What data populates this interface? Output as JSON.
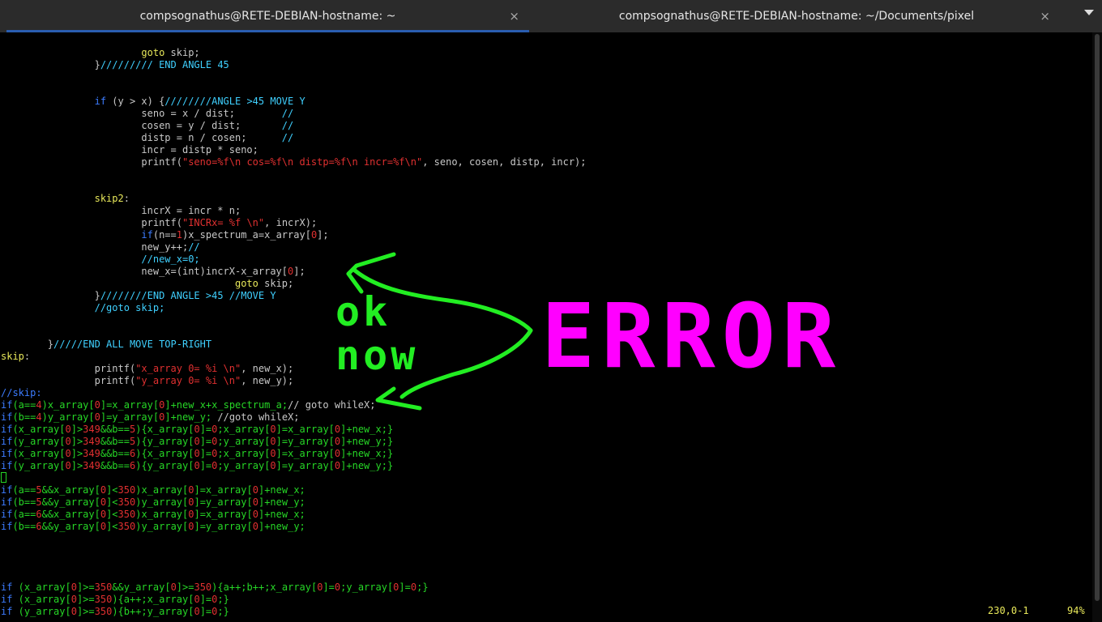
{
  "tabs": [
    {
      "title": "compsognathus@RETE-DEBIAN-hostname: ~",
      "active": true,
      "close": "×"
    },
    {
      "title": "compsognathus@RETE-DEBIAN-hostname: ~/Documents/pixel",
      "active": false,
      "close": "×"
    }
  ],
  "code_lines": [
    "                        goto skip;",
    "                }///////// END ANGLE 45",
    "",
    "",
    "                if (y > x) {////////ANGLE >45 MOVE Y",
    "                        seno = x / dist;        //",
    "                        cosen = y / dist;       //",
    "                        distp = n / cosen;      //",
    "                        incr = distp * seno;",
    "                        printf(\"seno=%f\\n cos=%f\\n distp=%f\\n incr=%f\\n\", seno, cosen, distp, incr);",
    "",
    "",
    "                skip2:",
    "                        incrX = incr * n;",
    "                        printf(\"INCRx= %f \\n\", incrX);",
    "                        if(n==1)x_spectrum_a=x_array[0];",
    "                        new_y++;//",
    "                        //new_x=0;",
    "                        new_x=(int)incrX-x_array[0];",
    "                                        goto skip;",
    "                }////////END ANGLE >45 //MOVE Y",
    "                //goto skip;",
    "",
    "",
    "        }/////END ALL MOVE TOP-RIGHT",
    "skip:",
    "                printf(\"x_array 0= %i \\n\", new_x);",
    "                printf(\"y_array 0= %i \\n\", new_y);",
    "//skip:",
    "if(a==4)x_array[0]=x_array[0]+new_x+x_spectrum_a;// goto whileX;",
    "if(b==4)y_array[0]=y_array[0]+new_y; //goto whileX;",
    "if(x_array[0]>349&&b==5){x_array[0]=0;x_array[0]=x_array[0]+new_x;}",
    "if(y_array[0]>349&&b==5){y_array[0]=0;y_array[0]=y_array[0]+new_y;}",
    "if(x_array[0]>349&&b==6){x_array[0]=0;x_array[0]=x_array[0]+new_x;}",
    "if(y_array[0]>349&&b==6){y_array[0]=0;y_array[0]=y_array[0]+new_y;}",
    "",
    "if(a==5&&x_array[0]<350)x_array[0]=x_array[0]+new_x;",
    "if(b==5&&y_array[0]<350)y_array[0]=y_array[0]+new_y;",
    "if(a==6&&x_array[0]<350)x_array[0]=x_array[0]+new_x;",
    "if(b==6&&y_array[0]<350)y_array[0]=y_array[0]+new_y;",
    "",
    "",
    "",
    "",
    "if (x_array[0]>=350&&y_array[0]>=350){a++;b++;x_array[0]=0;y_array[0]=0;}",
    "if (x_array[0]>=350){a++;x_array[0]=0;}",
    "if (y_array[0]>=350){b++;y_array[0]=0;}"
  ],
  "status": {
    "position": "230,0-1",
    "percent": "94%"
  },
  "annotation": {
    "text_ok": "ok",
    "text_now": "now",
    "text_error": "ERROR",
    "green": "#22ee22",
    "magenta": "#ff00ff"
  },
  "colors": {
    "tab_active_accent": "#2a5db0",
    "background": "#000000"
  }
}
